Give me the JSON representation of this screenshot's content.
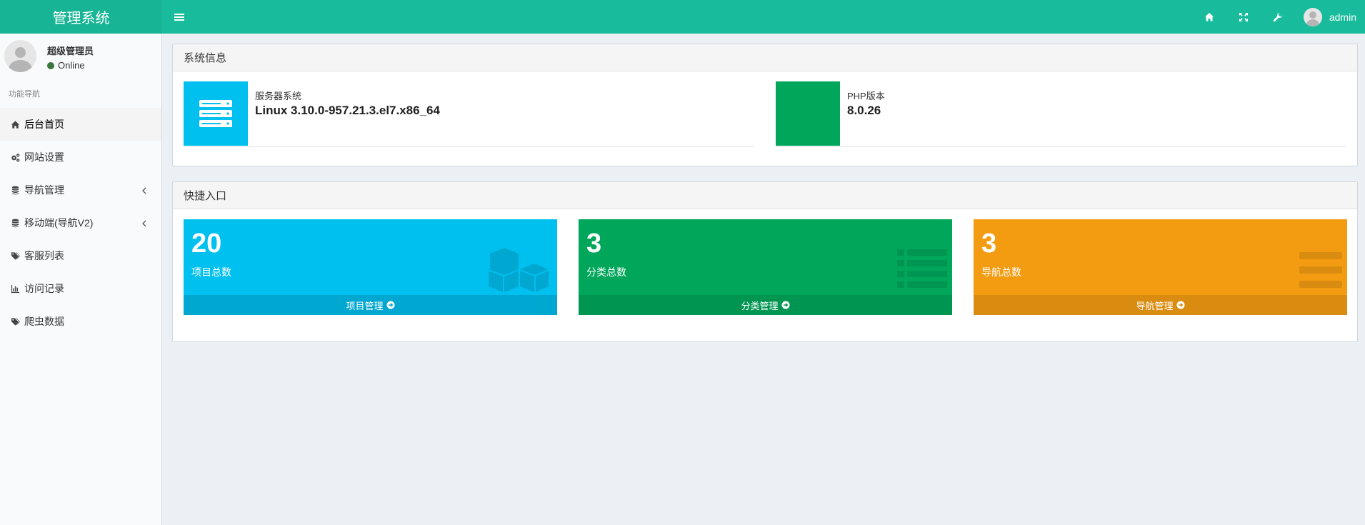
{
  "header": {
    "logo": "管理系统",
    "username": "admin"
  },
  "sidebar": {
    "user_name": "超级管理员",
    "user_status": "Online",
    "nav_header": "功能导航",
    "items": [
      {
        "label": "后台首页",
        "icon": "home-icon"
      },
      {
        "label": "网站设置",
        "icon": "gears-icon"
      },
      {
        "label": "导航管理",
        "icon": "database-icon"
      },
      {
        "label": "移动端(导航V2)",
        "icon": "database-icon"
      },
      {
        "label": "客服列表",
        "icon": "tags-icon"
      },
      {
        "label": "访问记录",
        "icon": "bar-chart-icon"
      },
      {
        "label": "爬虫数据",
        "icon": "tags-icon"
      }
    ]
  },
  "system_info": {
    "title": "系统信息",
    "server_label": "服务器系统",
    "server_value": "Linux 3.10.0-957.21.3.el7.x86_64",
    "php_label": "PHP版本",
    "php_value": "8.0.26"
  },
  "quick": {
    "title": "快捷入口",
    "cards": [
      {
        "count": "20",
        "label": "项目总数",
        "link": "项目管理",
        "color": "#00c0ef",
        "footer_color": "#00a7d0"
      },
      {
        "count": "3",
        "label": "分类总数",
        "link": "分类管理",
        "color": "#00a65a",
        "footer_color": "#009551"
      },
      {
        "count": "3",
        "label": "导航总数",
        "link": "导航管理",
        "color": "#f39c12",
        "footer_color": "#da8c10"
      }
    ]
  },
  "colors": {
    "header": "#18bc9c",
    "server_icon_bg": "#00c0ef",
    "php_icon_bg": "#00a65a"
  }
}
